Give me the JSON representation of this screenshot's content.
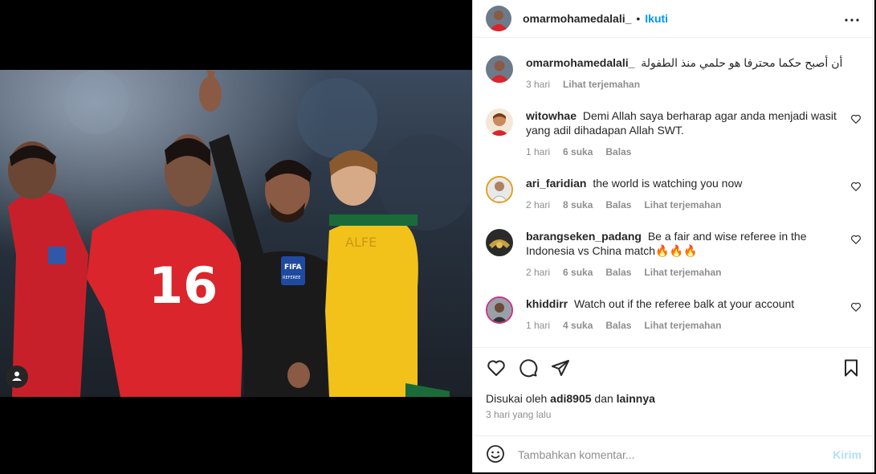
{
  "header": {
    "username": "omarmohamedalali_",
    "separator": "•",
    "follow_label": "Ikuti"
  },
  "caption": {
    "username": "omarmohamedalali_",
    "text": "أن أصبح حكما محترفا هو حلمي منذ الطفولة",
    "time": "3 hari",
    "translate": "Lihat terjemahan"
  },
  "comments": [
    {
      "username": "witowhae",
      "text": "Demi Allah saya berharap agar anda menjadi wasit yang adil dihadapan Allah SWT.",
      "time": "1 hari",
      "likes": "6 suka",
      "reply": "Balas",
      "translate": ""
    },
    {
      "username": "ari_faridian",
      "text": "the world is watching you now",
      "time": "2 hari",
      "likes": "8 suka",
      "reply": "Balas",
      "translate": "Lihat terjemahan"
    },
    {
      "username": "barangseken_padang",
      "text": "Be a fair and wise referee in the Indonesia vs China match🔥🔥🔥",
      "time": "2 hari",
      "likes": "6 suka",
      "reply": "Balas",
      "translate": "Lihat terjemahan"
    },
    {
      "username": "khiddirr",
      "text": "Watch out if the referee balk at your account",
      "time": "1 hari",
      "likes": "4 suka",
      "reply": "Balas",
      "translate": "Lihat terjemahan"
    }
  ],
  "likes": {
    "prefix": "Disukai oleh",
    "user": "adi8905",
    "conj": "dan",
    "others": "lainnya"
  },
  "posted": "3 hari yang lalu",
  "add_comment": {
    "placeholder": "Tambahkan komentar...",
    "post_label": "Kirim"
  },
  "photo": {
    "jersey_number": "16",
    "badge": "FIFA",
    "badge_sub": "REFEREE",
    "name_on_shirt": "ALFE"
  },
  "colors": {
    "accent": "#0095f6",
    "post_disabled": "#b2dffc",
    "muted": "#8e8e8e",
    "red_kit": "#d9252b",
    "yellow_kit": "#f2c21b",
    "referee_kit": "#1a1a1a"
  },
  "icons": {
    "more": "more-horizontal-icon",
    "like": "heart-icon",
    "comment": "comment-icon",
    "share": "paper-plane-icon",
    "save": "bookmark-icon",
    "emoji": "smiley-icon",
    "tag": "person-icon"
  }
}
